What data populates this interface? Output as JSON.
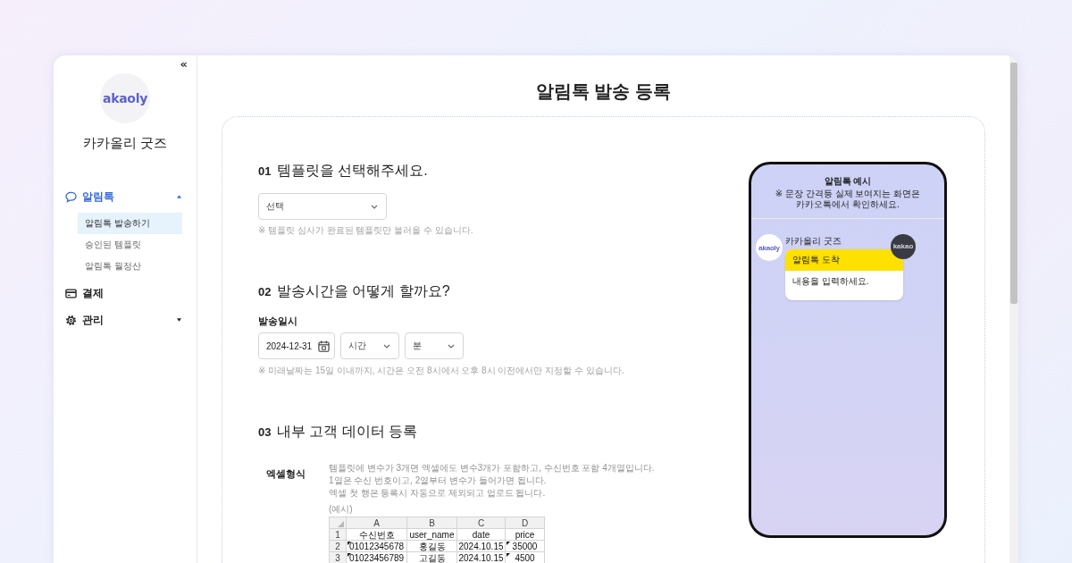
{
  "sidebar": {
    "collapse": "«",
    "logo": "akaoly",
    "shop_name": "카카올리 굿즈",
    "menu": [
      {
        "label": "알림톡",
        "selected": true,
        "expanded": true,
        "children": [
          {
            "label": "알림톡 발송하기",
            "selected": true
          },
          {
            "label": "승인된 템플릿",
            "selected": false
          },
          {
            "label": "알림톡 월정산",
            "selected": false
          }
        ]
      },
      {
        "label": "결제",
        "selected": false
      },
      {
        "label": "관리",
        "selected": false,
        "expanded": false
      }
    ]
  },
  "page": {
    "title": "알림톡 발송 등록"
  },
  "sections": [
    {
      "kind": "template",
      "number": "01",
      "title": "템플릿을 선택해주세요.",
      "select": {
        "value": "선택"
      },
      "note": "※ 템플릿 심사가 완료된 템플릿만 불러올 수 있습니다."
    },
    {
      "kind": "schedule",
      "number": "02",
      "title": "발송시간을 어떻게 할까요?",
      "label": "발송일시",
      "date": "2024-12-31",
      "hour": "시간",
      "minute": "분",
      "note": "※ 미래날짜는 15일 이내까지, 시간은 오전 8시에서 오후 8시 이전에서만 지정할 수 있습니다."
    },
    {
      "kind": "excel",
      "number": "03",
      "title": "내부 고객 데이터 등록",
      "label": "엑셀형식",
      "lines": [
        "템플릿에 변수가 3개면 엑셀에도 변수3개가 포함하고, 수신번호 포함 4개열입니다.",
        "1열은 수신 번호이고, 2열부터 변수가 들어가면 됩니다.",
        "엑셀 첫 행은 등록시 자동으로 제외되고 업로드 됩니다."
      ],
      "example_label": "(예시)",
      "sheet": {
        "columns": [
          "A",
          "B",
          "C",
          "D"
        ],
        "rows": [
          {
            "number": "1",
            "cells": [
              {
                "text": "수신번호",
                "flag": false
              },
              {
                "text": "user_name",
                "flag": false
              },
              {
                "text": "date",
                "flag": false
              },
              {
                "text": "price",
                "flag": false
              }
            ]
          },
          {
            "number": "2",
            "cells": [
              {
                "text": "01012345678",
                "flag": true
              },
              {
                "text": "홍길동",
                "flag": false
              },
              {
                "text": "2024.10.15",
                "flag": false
              },
              {
                "text": "35000",
                "flag": true
              }
            ]
          },
          {
            "number": "3",
            "cells": [
              {
                "text": "01023456789",
                "flag": true
              },
              {
                "text": "고길동",
                "flag": false
              },
              {
                "text": "2024.10.15",
                "flag": false
              },
              {
                "text": "4500",
                "flag": true
              }
            ]
          }
        ]
      }
    }
  ],
  "preview": {
    "title": "알림톡 예시",
    "note": "※ 문장 간격등 실제 보여지는 화면은 카카오톡에서 확인하세요.",
    "sender": {
      "avatar": "akaoly",
      "name": "카카올리 굿즈"
    },
    "badge": "kakao",
    "message": {
      "header": "알림톡 도착",
      "body": "내용을 입력하세요."
    }
  }
}
